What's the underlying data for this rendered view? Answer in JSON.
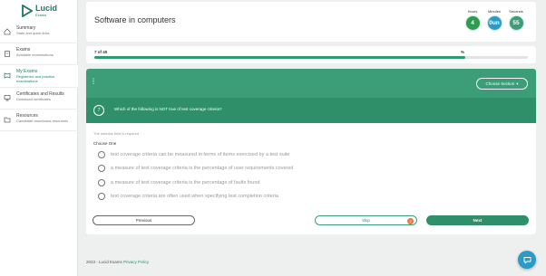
{
  "brand": {
    "name": "Lucid",
    "tagline": "Exams",
    "color": "#1e7a5a"
  },
  "sidebar": {
    "items": [
      {
        "title": "Summary",
        "desc": "Stats and quick links",
        "icon": "home-icon",
        "active": false
      },
      {
        "title": "Exams",
        "desc": "Available examinations",
        "icon": "clipboard-icon",
        "active": false
      },
      {
        "title": "My Exams",
        "desc": "Registered and practice examinations",
        "icon": "book-icon",
        "active": true
      },
      {
        "title": "Certificates and Results",
        "desc": "Download certificates",
        "icon": "certificate-icon",
        "active": false
      },
      {
        "title": "Resources",
        "desc": "Candidate downloads resources",
        "icon": "folder-icon",
        "active": false
      }
    ]
  },
  "header": {
    "title": "Software in computers",
    "timer": {
      "hours_label": "Hours",
      "hours": "4",
      "minutes_label": "Minutes",
      "minutes": "0un",
      "seconds_label": "Seconds",
      "seconds": "55"
    }
  },
  "progress": {
    "label": "7 of 40",
    "percent_text": "%",
    "fraction": 0.855
  },
  "section": {
    "button_label": "Choose Section"
  },
  "question": {
    "number": "7",
    "text": "Which of the following is NOT true of test coverage criteria?",
    "required_note": "The asterisk field is required",
    "choose_label": "Choose One",
    "options": [
      "test coverage criteria can be measured in terms of items exercised by a test suite",
      "a measure of test coverage criteria is the percentage of user requirements covered",
      "a measure of test coverage criteria is the percentage of faults found",
      "test coverage criteria are often used when specifying test completion criteria"
    ]
  },
  "actions": {
    "previous": "Previous",
    "skip": "Skip",
    "skip_count": "2",
    "next": "Next"
  },
  "footer": {
    "copyright": "2023 - Lucid Exams",
    "privacy": "Privacy Policy"
  },
  "colors": {
    "accent": "#2e8f69",
    "header_green": "#3b9e79",
    "chat": "#2a9bc9",
    "badge": "#e8793a"
  }
}
